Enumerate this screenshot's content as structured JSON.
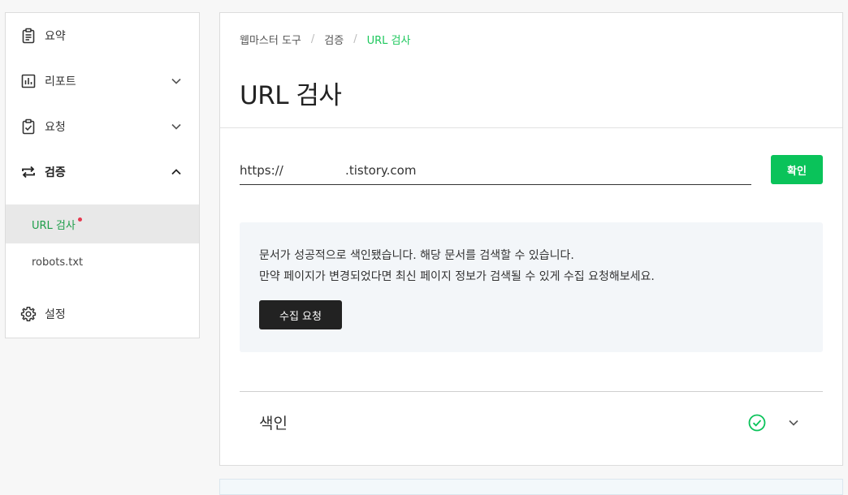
{
  "sidebar": {
    "items": [
      {
        "label": "요약",
        "icon": "clipboard-icon"
      },
      {
        "label": "리포트",
        "icon": "bar-chart-icon"
      },
      {
        "label": "요청",
        "icon": "check-clipboard-icon"
      },
      {
        "label": "검증",
        "icon": "swap-arrows-icon"
      },
      {
        "label": "설정",
        "icon": "gear-icon"
      }
    ],
    "subitems": [
      {
        "label": "URL 검사",
        "active": true,
        "badge": true
      },
      {
        "label": "robots.txt",
        "active": false
      }
    ]
  },
  "breadcrumb": {
    "items": [
      "웹마스터 도구",
      "검증",
      "URL 검사"
    ],
    "separator": "/"
  },
  "page": {
    "title": "URL 검사"
  },
  "url_input": {
    "value": "https://                .tistory.com"
  },
  "confirm_button": {
    "label": "확인"
  },
  "notice": {
    "line1": "문서가 성공적으로 색인됐습니다. 해당 문서를 검색할 수 있습니다.",
    "line2": "만약 페이지가 변경되었다면 최신 페이지 정보가 검색될 수 있게 수집 요청해보세요.",
    "button_label": "수집 요청"
  },
  "index_section": {
    "label": "색인",
    "status": "success"
  },
  "colors": {
    "accent_green": "#0ac35a",
    "breadcrumb_green": "#1ec85d",
    "badge_red": "#e63950",
    "dark_button": "#222222"
  }
}
